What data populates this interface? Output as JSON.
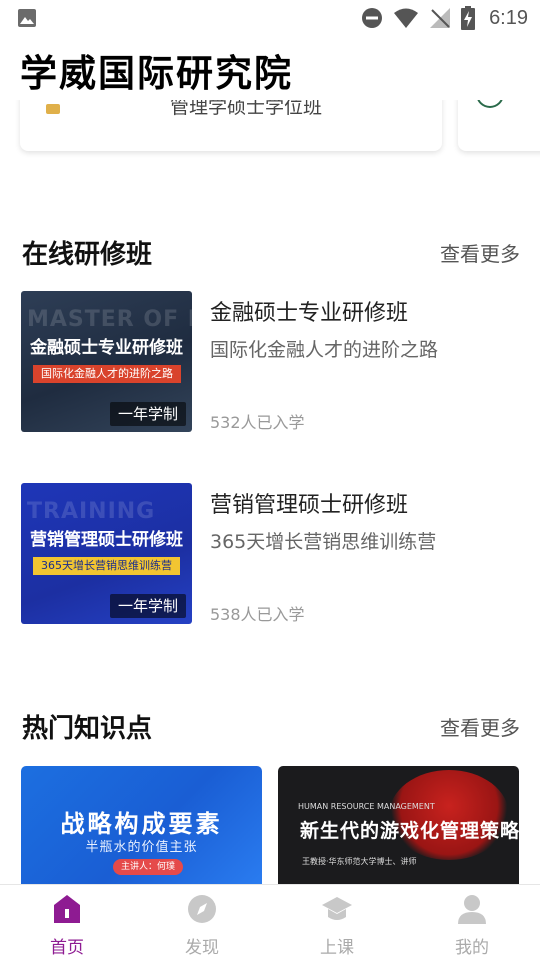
{
  "status_bar": {
    "time": "6:19"
  },
  "app": {
    "title": "学威国际研究院"
  },
  "banner": {
    "card_text": "管理学硕士学位班"
  },
  "online_section": {
    "title": "在线研修班",
    "more": "查看更多"
  },
  "courses": [
    {
      "name": "金融硕士专业研修班",
      "desc": "国际化金融人才的进阶之路",
      "count": "532人已入学",
      "thumb_title": "金融硕士专业研修班",
      "thumb_subtitle": "国际化金融人才的进阶之路",
      "thumb_bg_text": "MASTER OF FINANCE",
      "badge": "一年学制"
    },
    {
      "name": "营销管理硕士研修班",
      "desc": "365天增长营销思维训练营",
      "count": "538人已入学",
      "thumb_title": "营销管理硕士研修班",
      "thumb_subtitle": "365天增长营销思维训练营",
      "thumb_bg_text": "TRAINING",
      "badge": "一年学制"
    }
  ],
  "hot_section": {
    "title": "热门知识点",
    "more": "查看更多"
  },
  "knowledge": [
    {
      "title": "战略构成要素",
      "subtitle": "半瓶水的价值主张",
      "tag": "主讲人：何璞"
    },
    {
      "en": "HUMAN RESOURCE MANAGEMENT",
      "title": "新生代的游戏化管理策略",
      "author": "王教授·华东师范大学博士、讲师"
    }
  ],
  "tabs": [
    {
      "label": "首页",
      "icon": "home-icon"
    },
    {
      "label": "发现",
      "icon": "compass-icon"
    },
    {
      "label": "上课",
      "icon": "graduation-cap-icon"
    },
    {
      "label": "我的",
      "icon": "user-icon"
    }
  ],
  "colors": {
    "accent": "#8e1b92",
    "inactive": "#c8c8c8"
  }
}
